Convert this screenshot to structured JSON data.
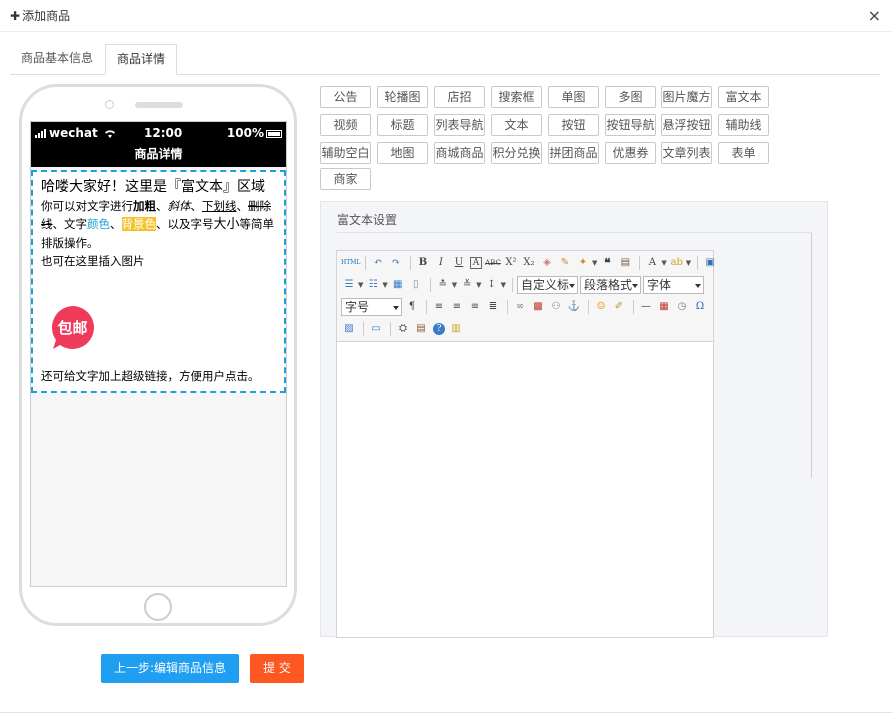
{
  "dialog": {
    "title": "添加商品",
    "close_glyph": "×"
  },
  "tabs": [
    {
      "label": "商品基本信息"
    },
    {
      "label": "商品详情",
      "active": true
    }
  ],
  "phone": {
    "carrier": "wechat",
    "time": "12:00",
    "battery": "100%",
    "page_title": "商品详情",
    "rich_text": {
      "heading": "哈喽大家好！这里是『富文本』区域",
      "line1_pre": "你可以对文字进行",
      "bold": "加粗",
      "sep1": "、",
      "italic": "斜体",
      "sep2": "、",
      "underline": "下划线",
      "sep3": "、",
      "strike": "删除线",
      "line1_mid": "、文字",
      "color_text": "颜色",
      "sep4": "、",
      "bg_text": "背景色",
      "line1_post1": "、以及字号",
      "big_text": "大小",
      "line1_post2": "等简单排版操作。",
      "line2": "也可在这里插入图片",
      "badge_text": "包邮",
      "link_line": "还可给文字加上超级链接，方便用户点击。"
    }
  },
  "components": [
    "公告",
    "轮播图",
    "店招",
    "搜索框",
    "单图",
    "多图",
    "图片魔方",
    "富文本",
    "视频",
    "标题",
    "列表导航",
    "文本",
    "按钮",
    "按钮导航",
    "悬浮按钮",
    "辅助线",
    "辅助空白",
    "地图",
    "商城商品",
    "积分兑换",
    "拼团商品",
    "优惠券",
    "文章列表",
    "表单",
    "商家"
  ],
  "settings": {
    "title": "富文本设置",
    "toolbar": {
      "html_label": "HTML",
      "select_custom": "自定义标",
      "select_paragraph": "段落格式",
      "select_font": "字体",
      "select_size": "字号"
    }
  },
  "buttons": {
    "prev": "上一步:编辑商品信息",
    "submit": "提 交"
  },
  "colors": {
    "primary": "#1f9ef2",
    "danger": "#ff5722",
    "dashed_border": "#1aa1d6",
    "badge": "#ef3b5a",
    "highlight_bg": "#f4c32c"
  }
}
